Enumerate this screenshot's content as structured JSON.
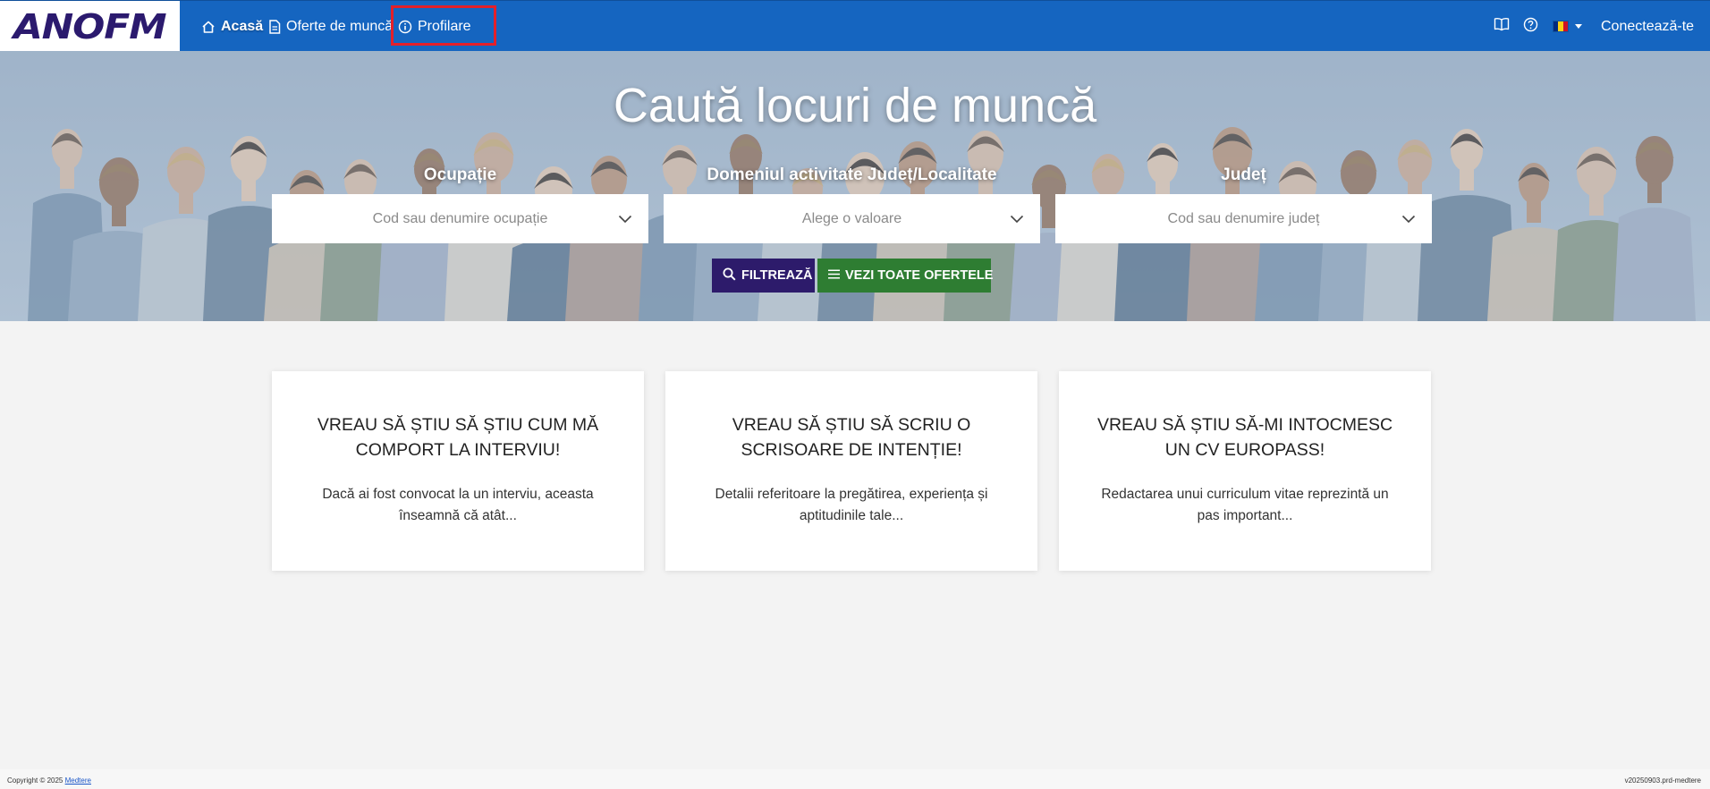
{
  "navbar": {
    "logo_text": "ANOFM",
    "home_label": "Acasă",
    "offers_label": "Oferte de muncă",
    "profile_label": "Profilare",
    "login_label": "Conectează-te",
    "colors": {
      "background": "#1565c0",
      "highlight": "#e3202a"
    },
    "icons": [
      "home-icon",
      "document-icon",
      "info-icon",
      "book-icon",
      "help-icon",
      "flag-icon",
      "caret-down-icon"
    ]
  },
  "hero": {
    "title": "Caută locuri de muncă",
    "fields": [
      {
        "label": "Ocupație",
        "placeholder": "Cod sau denumire ocupație"
      },
      {
        "label": "Domeniul activitate Județ/Localitate",
        "placeholder": "Alege o valoare"
      },
      {
        "label": "Județ",
        "placeholder": "Cod sau denumire județ"
      }
    ],
    "filter_button": "FILTREAZĂ",
    "all_offers_button": "VEZI TOATE OFERTELE",
    "colors": {
      "filter": "#2d1b6b",
      "all_offers": "#2e7d32"
    }
  },
  "cards": [
    {
      "title": "VREAU SĂ ȘTIU SĂ ȘTIU CUM MĂ COMPORT LA INTERVIU!",
      "text": "Dacă ai fost convocat la un interviu, aceasta înseamnă că atât..."
    },
    {
      "title": "VREAU SĂ ȘTIU SĂ SCRIU O SCRISOARE DE INTENȚIE!",
      "text": "Detalii referitoare la pregătirea, experiența și aptitudinile tale..."
    },
    {
      "title": "VREAU SĂ ȘTIU SĂ-MI INTOCMESC UN CV EUROPASS!",
      "text": "Redactarea unui curriculum vitae reprezintă un pas important..."
    }
  ],
  "footer": {
    "copyright": "Copyright © 2025",
    "link": "Medtere",
    "version": "v20250903.prd-medtere"
  }
}
